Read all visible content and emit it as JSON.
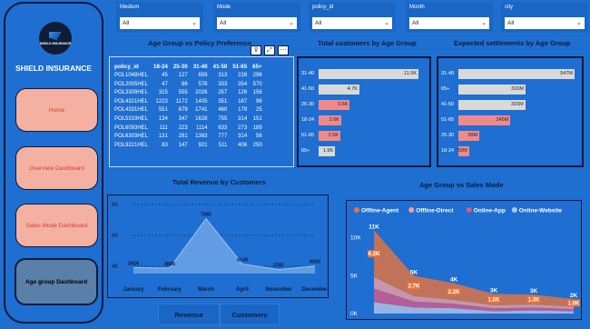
{
  "sidebar": {
    "logo_text": "SHIELD INSURANCE",
    "brand": "SHIELD INSURANCE",
    "items": [
      {
        "label": "Home"
      },
      {
        "label": "Overview Dashboard"
      },
      {
        "label": "Sales Mode Dashboard"
      },
      {
        "label": "Age group Dashboard"
      }
    ]
  },
  "slicers": [
    {
      "label": "Medium",
      "value": "All"
    },
    {
      "label": "Mode",
      "value": "All"
    },
    {
      "label": "policy_id",
      "value": "All"
    },
    {
      "label": "Month",
      "value": "All"
    },
    {
      "label": "city",
      "value": "All"
    }
  ],
  "table": {
    "title": "Age Group vs Policy Preference",
    "columns": [
      "policy_id",
      "18-24",
      "25-30",
      "31-40",
      "41-50",
      "51-65",
      "65+"
    ],
    "rows": [
      [
        "POL1048HEL",
        "45",
        "127",
        "659",
        "313",
        "228",
        "296"
      ],
      [
        "POL2005HEL",
        "47",
        "86",
        "578",
        "333",
        "354",
        "570"
      ],
      [
        "POL3309HEL",
        "315",
        "555",
        "2026",
        "257",
        "126",
        "156"
      ],
      [
        "POL4321HEL",
        "1223",
        "1172",
        "1405",
        "351",
        "187",
        "96"
      ],
      [
        "POL4331HEL",
        "551",
        "679",
        "1741",
        "460",
        "179",
        "25"
      ],
      [
        "POL5319HEL",
        "134",
        "347",
        "1628",
        "755",
        "314",
        "151"
      ],
      [
        "POL6093HEL",
        "111",
        "223",
        "1114",
        "633",
        "273",
        "189"
      ],
      [
        "POL6303HEL",
        "131",
        "281",
        "1383",
        "777",
        "314",
        "56"
      ],
      [
        "POL9221HEL",
        "83",
        "147",
        "921",
        "511",
        "406",
        "250"
      ]
    ],
    "visual_icons": [
      "filter-icon",
      "focus-icon",
      "more-icon"
    ],
    "icon_glyphs": [
      "⊽",
      "⤢",
      "⋯"
    ]
  },
  "customers_chart": {
    "title": "Total customers by Age Group",
    "chart_data": {
      "type": "bar",
      "orientation": "horizontal",
      "categories": [
        "31-40",
        "41-50",
        "25-30",
        "18-24",
        "51-65",
        "65+"
      ],
      "values": [
        11500,
        4700,
        3600,
        2600,
        2500,
        1900
      ],
      "labels": [
        "11.5K",
        "4.7K",
        "3.6K",
        "2.6K",
        "2.5K",
        "1.9K"
      ],
      "colors": [
        "#d9d9d9",
        "#d9d9d9",
        "#f08a8a",
        "#f08a8a",
        "#f08a8a",
        "#d9d9d9"
      ]
    }
  },
  "settlements_chart": {
    "title": "Expected settlements by Age Group",
    "chart_data": {
      "type": "bar",
      "orientation": "horizontal",
      "categories": [
        "31-40",
        "65+",
        "41-50",
        "51-65",
        "25-30",
        "18-24"
      ],
      "values": [
        547,
        316,
        315,
        245,
        99,
        50
      ],
      "labels": [
        "547M",
        "316M",
        "315M",
        "245M",
        "99M",
        "50M"
      ],
      "colors": [
        "#d9d9d9",
        "#d9d9d9",
        "#d9d9d9",
        "#f08a8a",
        "#f08a8a",
        "#f08a8a"
      ]
    }
  },
  "revenue_chart": {
    "title": "Total Revenue by Customers",
    "chart_data": {
      "type": "area",
      "categories": [
        "January",
        "February",
        "March",
        "April",
        "November",
        "December"
      ],
      "values": [
        3919,
        3885,
        7081,
        4149,
        3787,
        4020
      ],
      "labels": [
        "3919",
        "3885",
        "7081",
        "4149",
        "3787",
        "4020"
      ],
      "yticks": [
        "8K",
        "6K",
        "4K"
      ],
      "ylim": [
        4000,
        8000
      ]
    }
  },
  "mode_chart": {
    "title": "Age Group vs Sales Mode",
    "legend": [
      {
        "name": "Offline-Agent",
        "color": "#e8743b"
      },
      {
        "name": "Offline-Direct",
        "color": "#f0a0a0"
      },
      {
        "name": "Online-App",
        "color": "#d85a8a"
      },
      {
        "name": "Online-Website",
        "color": "#b5c7e8"
      }
    ],
    "chart_data": {
      "type": "area",
      "stacked": true,
      "categories": [
        "31-40",
        "41-50",
        "25-30",
        "18-24",
        "51-65",
        "65+"
      ],
      "yticks": [
        "10K",
        "5K",
        "0K"
      ],
      "ylim": [
        0,
        12000
      ],
      "totals_labels": [
        "11K",
        "5K",
        "4K",
        "3K",
        "3K",
        "2K"
      ],
      "segment_labels": [
        "6.2K",
        "2.7K",
        "2.2K",
        "1.5K",
        "1.3K",
        "1.0K"
      ],
      "series": [
        {
          "name": "Offline-Agent",
          "values": [
            6200,
            2700,
            2200,
            1500,
            1300,
            1000
          ]
        },
        {
          "name": "Offline-Direct",
          "values": [
            1500,
            700,
            500,
            400,
            400,
            300
          ]
        },
        {
          "name": "Online-App",
          "values": [
            1800,
            800,
            600,
            400,
            400,
            300
          ]
        },
        {
          "name": "Online-Website",
          "values": [
            1500,
            800,
            700,
            300,
            400,
            300
          ]
        }
      ]
    }
  },
  "bottom_buttons": [
    {
      "label": "Revenue"
    },
    {
      "label": "Customers"
    }
  ]
}
